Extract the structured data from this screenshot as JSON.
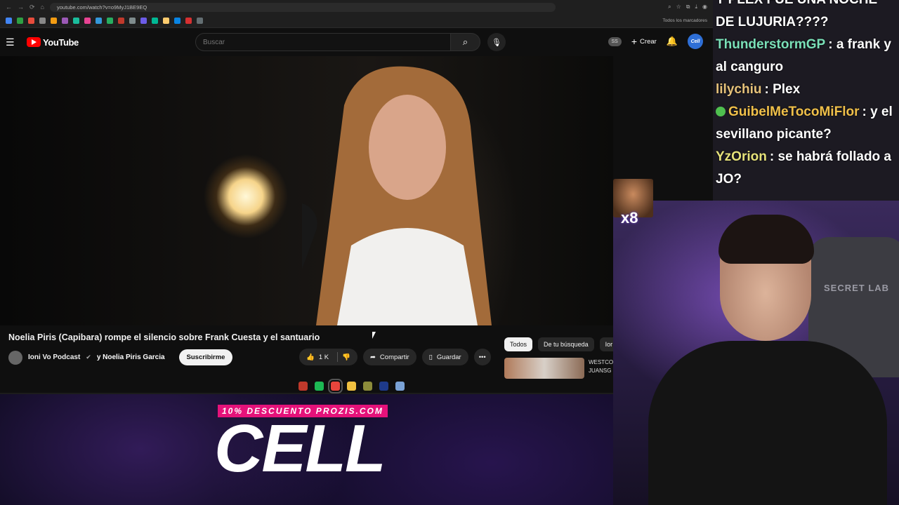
{
  "browser": {
    "url": "youtube.com/watch?v=o9MyJ1BE9EQ",
    "bookmarks_all": "Todos los marcadores"
  },
  "youtube": {
    "logo": "YouTube",
    "search_placeholder": "Buscar",
    "ss_badge": "SS",
    "create_label": "Crear",
    "avatar_text": "Cell"
  },
  "video": {
    "title": "Noelia Piris (Capibara) rompe el silencio sobre Frank Cuesta y el santuario",
    "channel": "Ioni Vo Podcast",
    "collab": "y Noelia Piris Garcia",
    "subscribe": "Suscribirme",
    "likes": "1 K",
    "share": "Compartir",
    "save": "Guardar"
  },
  "chips": [
    "Todos",
    "De tu búsqueda",
    "Ior"
  ],
  "recommendation": {
    "text": "WESTCO JUANSG"
  },
  "chat": [
    {
      "user": "",
      "text": "Y PLEX FUE UNA NOCHE DE LUJURIA????",
      "color": "#ffffff",
      "badge": false
    },
    {
      "user": "ThunderstormGP",
      "text": ": a frank y al canguro",
      "color": "#7ae0b8",
      "badge": false
    },
    {
      "user": "lilychiu",
      "text": ": Plex",
      "color": "#e6c27a",
      "badge": false
    },
    {
      "user": "GuibelMeTocoMiFlor",
      "text": ": y el sevillano picante?",
      "color": "#f0c04a",
      "badge": true
    },
    {
      "user": "YzOrion",
      "text": ": se habrá follado a JO?",
      "color": "#e6e27a",
      "badge": false
    }
  ],
  "emote_count": "x8",
  "webcam": {
    "chair_text": "SECRET LAB"
  },
  "promo": {
    "tag": "10% DESCUENTO PROZIS.COM",
    "big": "CELL"
  }
}
